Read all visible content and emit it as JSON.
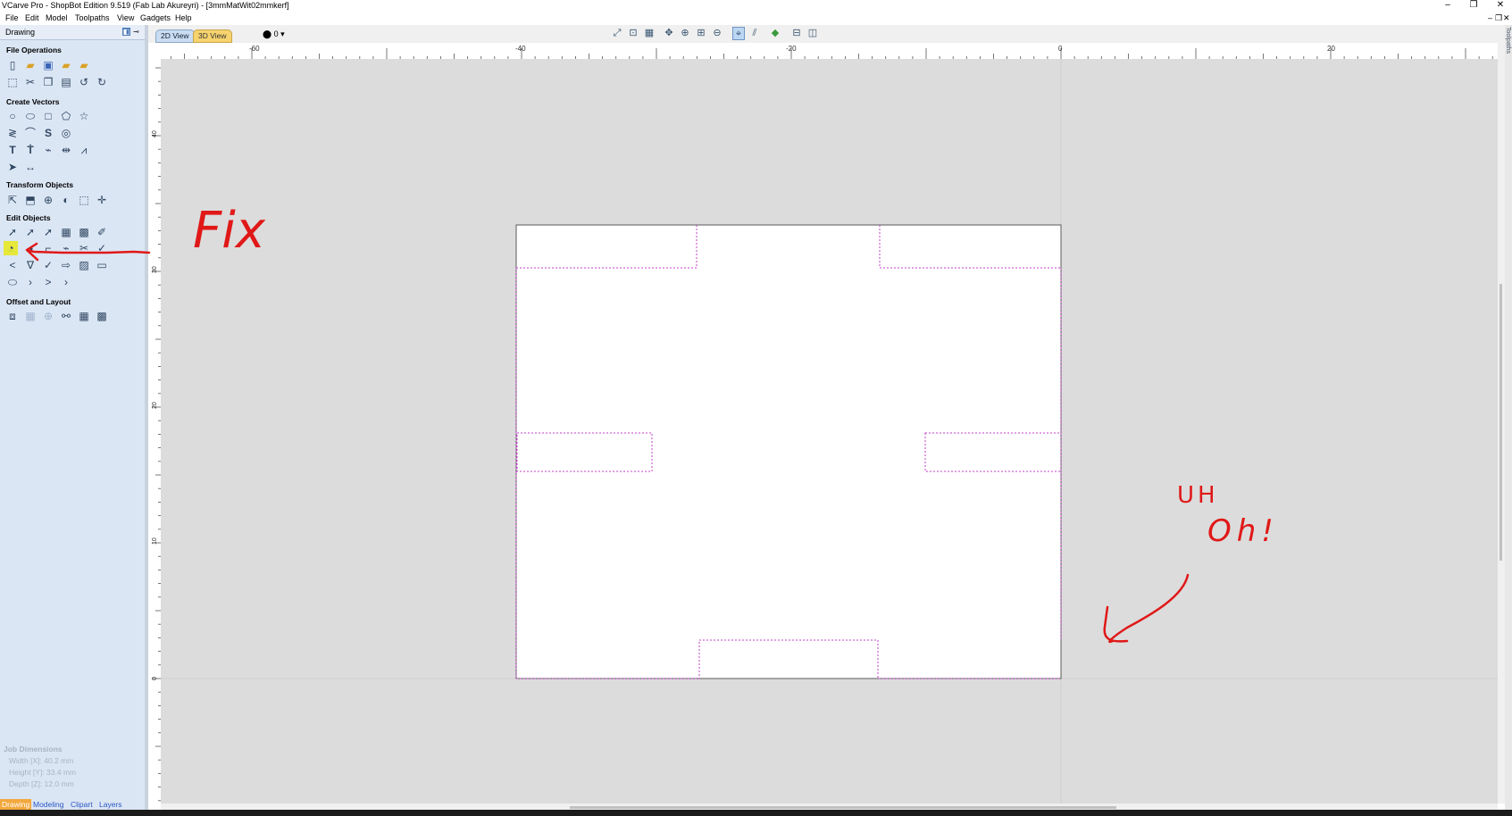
{
  "window": {
    "title": "VCarve Pro - ShopBot Edition 9.519 (Fab Lab Akureyri) - [3mmMatWit02mmkerf]",
    "controls": {
      "minimize": "–",
      "restore": "❐",
      "close": "✕"
    }
  },
  "menu": {
    "items": [
      "File",
      "Edit",
      "Model",
      "Toolpaths",
      "View",
      "Gadgets",
      "Help"
    ],
    "mdi": {
      "minimize": "–",
      "restore": "❐",
      "close": "✕"
    }
  },
  "panel": {
    "title": "Drawing",
    "sections": {
      "file_operations": "File Operations",
      "create_vectors": "Create Vectors",
      "transform_objects": "Transform Objects",
      "edit_objects": "Edit Objects",
      "offset_layout": "Offset and Layout"
    },
    "job_dimensions": {
      "title": "Job Dimensions",
      "width": "Width  [X]: 40.2 mm",
      "height": "Height [Y]: 33.4 mm",
      "depth": "Depth  [Z]: 12.0 mm"
    },
    "bottom_tabs": [
      "Drawing",
      "Modeling",
      "Clipart",
      "Layers"
    ]
  },
  "view_tabs": {
    "tab_2d": "2D View",
    "tab_3d": "3D View",
    "layer_selector": "0 ▾"
  },
  "ruler": {
    "top_labels": [
      "-60",
      "-40",
      "-20",
      "0",
      "20"
    ],
    "left_labels": [
      "40",
      "30",
      "20",
      "10",
      "0"
    ]
  },
  "annotations": {
    "fix": "Fix",
    "uh": "UH",
    "oh": "Oh!"
  },
  "right_tab": "Toolpaths",
  "colors": {
    "panel_bg": "#dbe6f4",
    "canvas_bg": "#dcdcdc",
    "vector_magenta": "#c040c8",
    "annotation_red": "#e01818",
    "highlight_yellow": "#e6e83a"
  }
}
